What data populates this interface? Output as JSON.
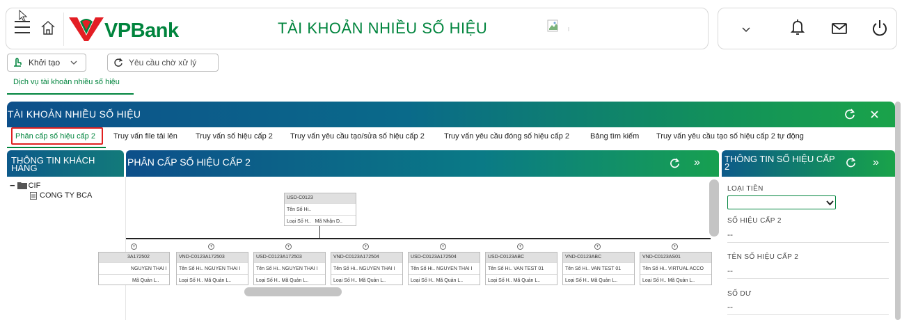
{
  "header": {
    "brand": "VPBank",
    "title": "TÀI KHOẢN NHIỀU SỐ HIỆU"
  },
  "toolbar": {
    "init_label": "Khởi tạo",
    "pending_label": "Yêu cầu chờ xử lý"
  },
  "service_link": "Dịch vụ tài khoản nhiều số hiệu",
  "main_panel": {
    "title": "TÀI KHOẢN NHIỀU SỐ HIỆU"
  },
  "tabs": [
    {
      "label": "Phân cấp số hiệu cấp 2"
    },
    {
      "label": "Truy vấn file tải lên"
    },
    {
      "label": "Truy vấn số hiệu cấp 2"
    },
    {
      "label": "Truy vấn yêu cầu tạo/sửa số hiệu cấp 2"
    },
    {
      "label": "Truy vấn yêu cầu đóng số hiệu cấp 2"
    },
    {
      "label": "Bảng tìm kiếm"
    },
    {
      "label": "Truy vấn yêu cầu tạo số hiệu cấp 2 tự động"
    }
  ],
  "customer_panel": {
    "title_line1": "THÔNG TIN KHÁCH",
    "title_line2": "HÀNG",
    "tree_root": "CIF",
    "tree_child": "CONG TY BCA"
  },
  "hierarchy_panel": {
    "title": "PHÂN CẤP SỐ HIỆU CẤP 2",
    "root": {
      "code": "USD-C0123",
      "name": "Tên Số Hi..",
      "row2a": "Loại Số H..",
      "row2b": "Mã Nhận D.."
    },
    "children": [
      {
        "code": "3A172502",
        "name": "NGUYEN THAI I",
        "row2": "Mã Quản L.."
      },
      {
        "code": "VND-C0123A172503",
        "name": "Tên Số Hi..  NGUYEN THAI I",
        "row2": "Loại Số H..   Mã Quản L.."
      },
      {
        "code": "USD-C0123A172503",
        "name": "Tên Số Hi..  NGUYEN THAI I",
        "row2": "Loại Số H..   Mã Quản L.."
      },
      {
        "code": "VND-C0123A172504",
        "name": "Tên Số Hi..  NGUYEN THAI I",
        "row2": "Loại Số H..   Mã Quản L.."
      },
      {
        "code": "USD-C0123A172504",
        "name": "Tên Số Hi..  NGUYEN THAI I",
        "row2": "Loại Số H..   Mã Quản L.."
      },
      {
        "code": "USD-C0123ABC",
        "name": "Tên Số Hi..  VAN TEST 01",
        "row2": "Loại Số H..   Mã Quản L.."
      },
      {
        "code": "VND-C0123ABC",
        "name": "Tên Số Hi..  VAN TEST 01",
        "row2": "Loại Số H..   Mã Quản L.."
      },
      {
        "code": "VND-C0123AS01",
        "name": "Tên Số Hi..  VIRTUAL ACCO",
        "row2": "Loại Số H..   Mã Quản L.."
      }
    ]
  },
  "detail_panel": {
    "title_line1": "THÔNG TIN SỐ HIỆU CẤP",
    "title_line2": "2",
    "currency_label": "LOẠI TIỀN",
    "sub_account_label": "SỐ HIỆU CẤP 2",
    "sub_account_value": "--",
    "sub_account_name_label": "TÊN SỐ HIỆU CẤP 2",
    "sub_account_name_value": "--",
    "balance_label": "SỐ DƯ",
    "balance_value": "--"
  },
  "colors": {
    "brand_green": "#00843d",
    "brand_red": "#e31e24",
    "header_gradient_start": "#0d4f8a",
    "header_gradient_end": "#1aa34a",
    "active_tab_border": "#e02020"
  }
}
